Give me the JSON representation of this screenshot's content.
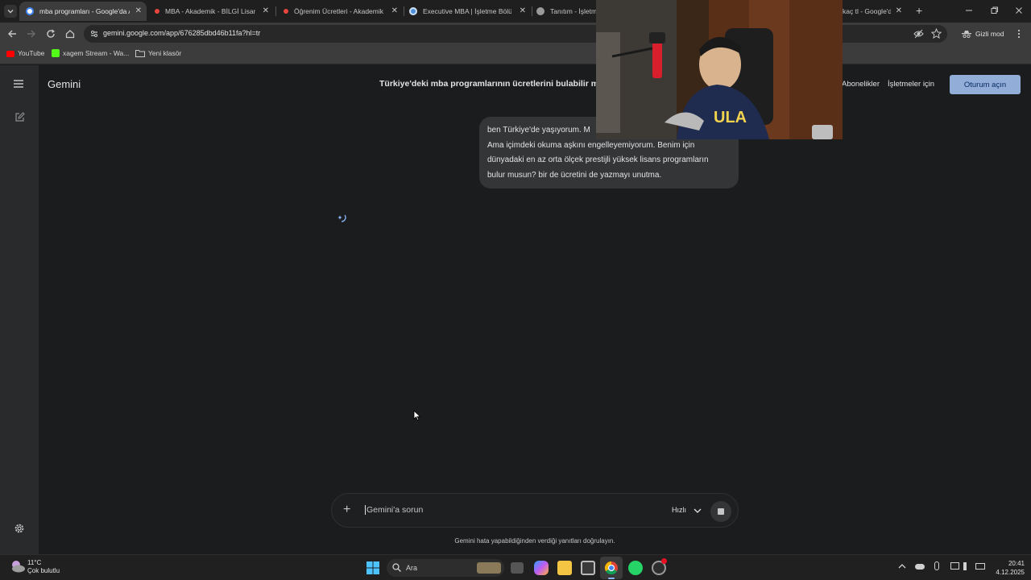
{
  "browser": {
    "tabs": [
      {
        "title": "mba programları - Google'da A",
        "favicon_color": "#8ab4f8"
      },
      {
        "title": "MBA - Akademik - BİLGİ Lisansü",
        "favicon_color": "#e8453c"
      },
      {
        "title": "Öğrenim Ücretleri - Akademik",
        "favicon_color": "#e8453c"
      },
      {
        "title": "Executive MBA | İşletme Bölümü",
        "favicon_color": "#4f8fdc"
      },
      {
        "title": "Tanıtım - İşletme",
        "favicon_color": "#9a9a9a"
      },
      {
        "title": "kaç tl - Google'd",
        "favicon_color": "#8ab4f8"
      }
    ],
    "new_tab_symbol": "+",
    "url": "gemini.google.com/app/676285dbd46b11fa?hl=tr",
    "incognito_label": "Gizli mod",
    "bookmarks": [
      {
        "label": "YouTube",
        "icon": "youtube-icon",
        "color": "#ff0000"
      },
      {
        "label": "xagem Stream - Wa...",
        "icon": "kick-icon",
        "color": "#53fc18"
      },
      {
        "label": "Yeni klasör",
        "icon": "folder-icon",
        "color": "#c4c7c5"
      }
    ]
  },
  "gemini": {
    "brand": "Gemini",
    "chat_title": "Türkiye'deki mba programlarının ücretlerini bulabilir m",
    "links": {
      "subscriptions": "Abonelikler",
      "business": "İşletmeler için"
    },
    "signin_label": "Oturum açın",
    "user_message_lines": [
      "ben Türkiye'de yaşıyorum. M",
      "Ama içimdeki okuma aşkını engelleyemiyorum. Benim için",
      "dünyadaki en az orta ölçek prestijli yüksek lisans programların",
      "bulur musun? bir de ücretini de yazmayı unutma."
    ],
    "composer": {
      "placeholder": "Gemini'a sorun",
      "mode_label": "Hızlı"
    },
    "disclaimer": "Gemini hata yapabildiğinden verdiği yanıtları doğrulayın.",
    "accent": "#a8c7fa"
  },
  "taskbar": {
    "weather_temp": "11°C",
    "weather_desc": "Çok bulutlu",
    "search_label": "Ara",
    "time": "20:41",
    "date": "4.12.2025"
  }
}
